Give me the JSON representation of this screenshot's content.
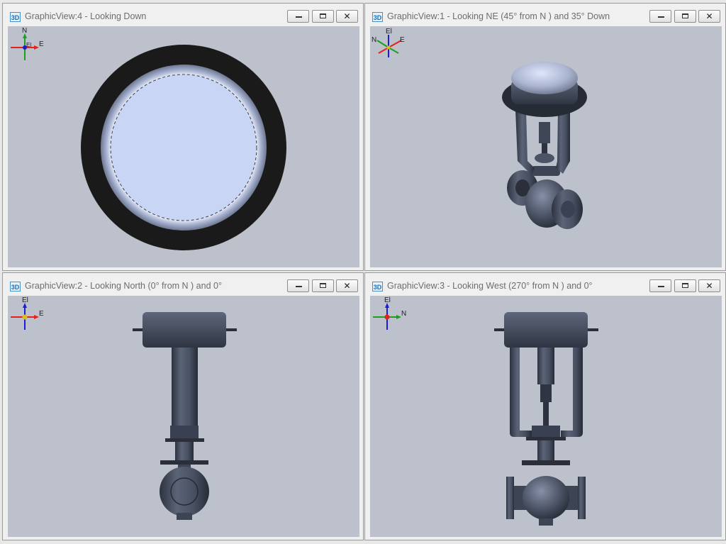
{
  "views": [
    {
      "title": "GraphicView:4 - Looking Down",
      "axes": {
        "up": "N",
        "right": "E",
        "center": "El"
      }
    },
    {
      "title": "GraphicView:1 - Looking NE (45° from N ) and 35° Down",
      "axes": {
        "up": "El",
        "left": "N",
        "right": "E"
      }
    },
    {
      "title": "GraphicView:2 - Looking North (0° from N ) and 0°",
      "axes": {
        "up": "El",
        "right": "E"
      }
    },
    {
      "title": "GraphicView:3 - Looking West (270° from N ) and 0°",
      "axes": {
        "up": "El",
        "right": "N"
      }
    }
  ],
  "app_icon": "3D",
  "window_buttons": {
    "minimize": "minimize-icon",
    "maximize": "restore-icon",
    "close": "close-icon",
    "close_glyph": "✕"
  },
  "colors": {
    "viewport_bg": "#bcc1cc",
    "steel": "#454d5e",
    "disc": "#c9d5f5",
    "axis_x": "#e8201c",
    "axis_y": "#1aa11a",
    "axis_z": "#1c1cd8"
  }
}
